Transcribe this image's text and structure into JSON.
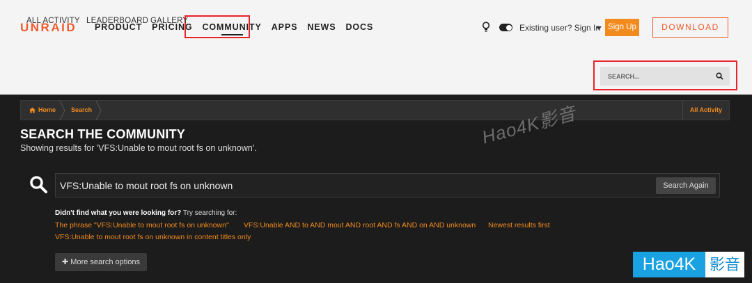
{
  "header": {
    "logo": "UNRAID",
    "nav": [
      "PRODUCT",
      "PRICING",
      "COMMUNITY",
      "APPS",
      "NEWS",
      "DOCS"
    ],
    "signin": "Existing user? Sign In",
    "signup": "Sign Up",
    "download": "DOWNLOAD"
  },
  "subnav": {
    "items": [
      "ALL ACTIVITY",
      "LEADERBOARD",
      "GALLERY"
    ],
    "search_placeholder": "SEARCH..."
  },
  "breadcrumb": {
    "home": "Home",
    "current": "Search",
    "all_activity": "All Activity"
  },
  "page": {
    "title": "SEARCH THE COMMUNITY",
    "subtitle": "Showing results for 'VFS:Unable to mout root fs on unknown'."
  },
  "search": {
    "query": "VFS:Unable to mout root fs on unknown",
    "button": "Search Again"
  },
  "suggestions": {
    "lead_bold": "Didn't find what you were looking for?",
    "lead_rest": " Try searching for:",
    "links": [
      "The phrase \"VFS:Unable to mout root fs on unknown\"",
      "VFS:Unable AND to AND mout AND root AND fs AND on AND unknown",
      "Newest results first",
      "VFS:Unable to mout root fs on unknown in content titles only"
    ]
  },
  "more_options": "More search options",
  "watermark": {
    "text": "Hao4K影音",
    "badge_left": "Hao4K",
    "badge_right": "影音"
  },
  "colors": {
    "accent": "#f28b1e",
    "brand": "#f15a2c",
    "highlight": "#e8232a"
  }
}
